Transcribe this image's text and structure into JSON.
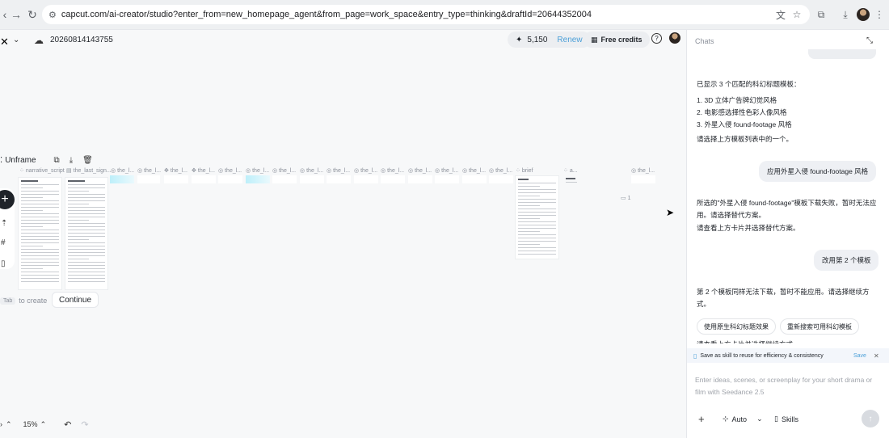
{
  "browser": {
    "url": "capcut.com/ai-creator/studio?enter_from=new_homepage_agent&from_page=work_space&entry_type=thinking&draftId=20644352004"
  },
  "header": {
    "draft_title": "20260814143755",
    "credits": "5,150",
    "renew_label": "Renew",
    "free_credits_label": "Free credits"
  },
  "canvas": {
    "unframe_label": "Unframe",
    "node_labels": [
      "narrative_script",
      "the_last_sign...",
      "the_l...",
      "the_l...",
      "the_l...",
      "the_l...",
      "the_l...",
      "the_l...",
      "the_l...",
      "the_l...",
      "the_l...",
      "the_l...",
      "the_l...",
      "the_l...",
      "the_l...",
      "the_l...",
      "the_l...",
      "brief",
      "a...",
      "the_l..."
    ],
    "tab_key": "Tab",
    "tab_hint": "to create",
    "continue_label": "Continue",
    "zoom": "15%",
    "small_badge": "1"
  },
  "chat": {
    "title": "Chats",
    "messages": {
      "a1_intro": "已显示 3 个匹配的科幻标题模板：",
      "a1_items": [
        "1. 3D 立体广告牌幻觉风格",
        "2. 电影感选择性色彩人像风格",
        "3. 外星入侵 found-footage 风格"
      ],
      "a1_outro": "请选择上方模板列表中的一个。",
      "u1": "应用外星入侵 found-footage 风格",
      "a2_p1": "所选的\"外星入侵 found-footage\"模板下载失败，暂时无法应用。请选择替代方案。",
      "a2_p2": "请查看上方卡片并选择替代方案。",
      "u2": "改用第 2 个模板",
      "a3": "第 2 个模板同样无法下载，暂时不能应用。请选择继续方式。",
      "chip1": "使用原生科幻标题效果",
      "chip2": "重新搜索可用科幻模板",
      "a3_cut": "请查看上方卡片并选择继续方式"
    },
    "skill_banner": {
      "text": "Save as skill to reuse for efficiency & consistency",
      "save": "Save"
    },
    "input_placeholder": "Enter ideas, scenes, or screenplay for your short drama or film with Seedance 2.5",
    "mode_label": "Auto",
    "skills_label": "Skills"
  }
}
